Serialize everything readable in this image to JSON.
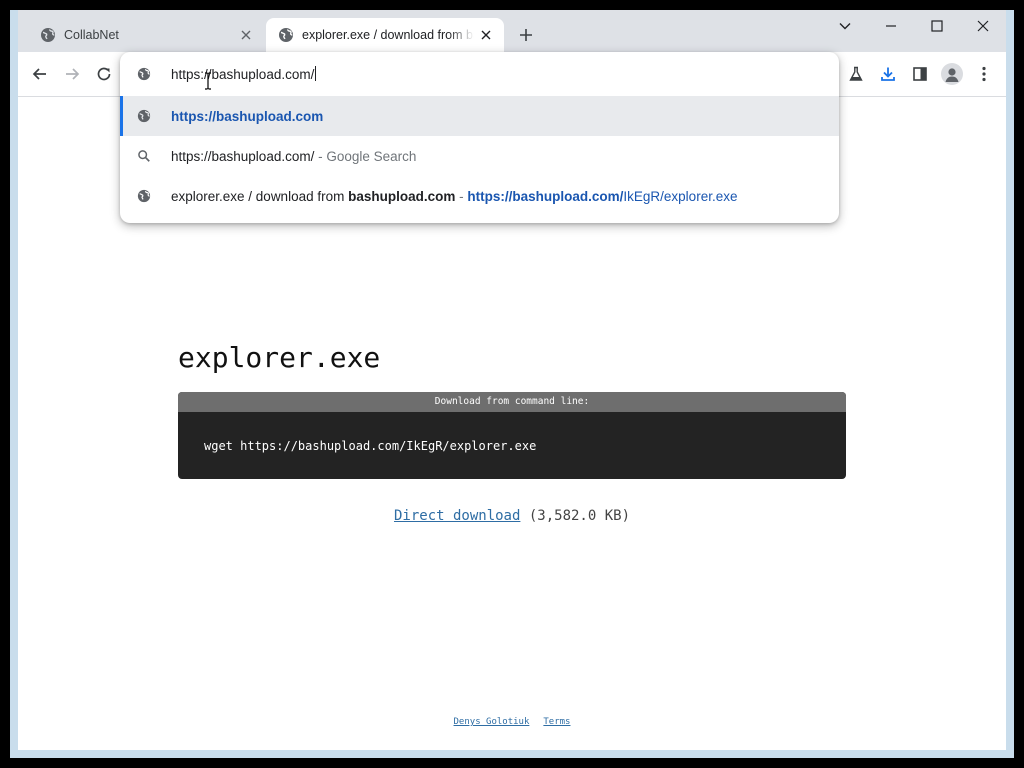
{
  "tabs": [
    {
      "title": "CollabNet",
      "icon": "globe-icon"
    },
    {
      "title": "explorer.exe / download from bashupload.com",
      "icon": "globe-icon",
      "active": true
    }
  ],
  "omnibox": {
    "input_value": "https://bashupload.com/",
    "suggestions": [
      {
        "icon": "globe-icon",
        "url": "https://bashupload.com",
        "selected": true
      },
      {
        "icon": "search-icon",
        "query": "https://bashupload.com/",
        "sep": " - ",
        "provider": "Google Search"
      },
      {
        "icon": "globe-icon",
        "title_pre": "explorer.exe / download from ",
        "title_bold": "bashupload",
        "title_post": ".com",
        "sep": " - ",
        "url_bold": "https://bashupload.com/",
        "url_rest": "IkEgR/explorer.exe"
      }
    ]
  },
  "page": {
    "filename": "explorer.exe",
    "cmd_header": "Download from command line:",
    "cmd": "wget https://bashupload.com/IkEgR/explorer.exe",
    "download_link": "Direct download",
    "download_size": "(3,582.0 KB)",
    "footer": {
      "author": "Denys Golotiuk",
      "terms": "Terms"
    }
  },
  "colors": {
    "accent": "#1a73e8",
    "link": "#2e6da4",
    "code_bg": "#232323",
    "code_header": "#6e6e6e"
  }
}
